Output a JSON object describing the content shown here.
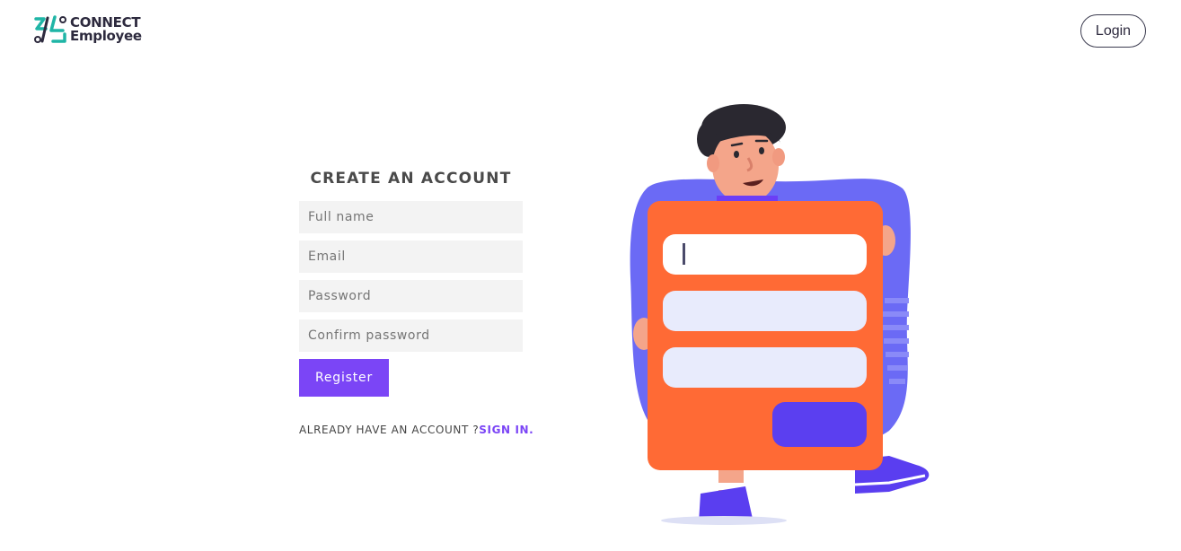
{
  "header": {
    "logo_line1": "CONNECT",
    "logo_line2": "Employee",
    "login_label": "Login"
  },
  "form": {
    "title": "CREATE AN ACCOUNT",
    "fields": {
      "full_name_placeholder": "Full name",
      "email_placeholder": "Email",
      "password_placeholder": "Password",
      "confirm_placeholder": "Confirm password"
    },
    "register_label": "Register",
    "already_text": "ALREADY HAVE AN ACCOUNT ?",
    "signin_label": "SIGN IN."
  },
  "colors": {
    "accent": "#7b45f6",
    "teal": "#1fb5a6",
    "orange": "#ff6a35",
    "blob": "#6b6af5"
  },
  "icons": {
    "logo": "connect-employee-logo-icon",
    "illustration": "person-holding-form-illustration"
  }
}
